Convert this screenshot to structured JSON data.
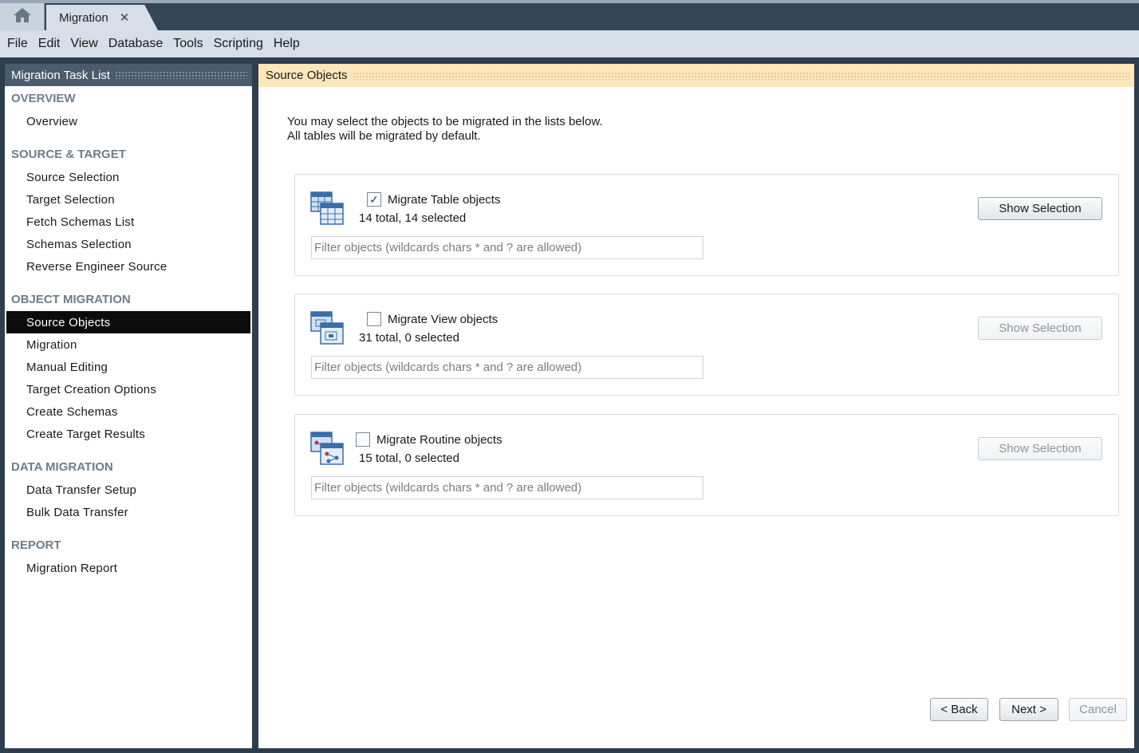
{
  "tabs": {
    "home_icon": "home-icon",
    "document": {
      "title": "Migration",
      "close_glyph": "✕"
    }
  },
  "menubar": [
    "File",
    "Edit",
    "View",
    "Database",
    "Tools",
    "Scripting",
    "Help"
  ],
  "sidebar": {
    "title": "Migration Task List",
    "sections": [
      {
        "title": "OVERVIEW",
        "items": [
          "Overview"
        ]
      },
      {
        "title": "SOURCE & TARGET",
        "items": [
          "Source Selection",
          "Target Selection",
          "Fetch Schemas List",
          "Schemas Selection",
          "Reverse Engineer Source"
        ]
      },
      {
        "title": "OBJECT MIGRATION",
        "items": [
          "Source Objects",
          "Migration",
          "Manual Editing",
          "Target Creation Options",
          "Create Schemas",
          "Create Target Results"
        ]
      },
      {
        "title": "DATA MIGRATION",
        "items": [
          "Data Transfer Setup",
          "Bulk Data Transfer"
        ]
      },
      {
        "title": "REPORT",
        "items": [
          "Migration Report"
        ]
      }
    ],
    "active_item": "Source Objects"
  },
  "main": {
    "title": "Source Objects",
    "intro_line1": "You may select the objects to be migrated in the lists below.",
    "intro_line2": "All tables will be migrated by default.",
    "panels": [
      {
        "label": "Migrate Table objects",
        "count": "14 total, 14 selected",
        "checked": true,
        "filter_placeholder": "Filter objects (wildcards chars * and ? are allowed)",
        "button": "Show Selection",
        "button_enabled": true,
        "icon": "table-objects-icon"
      },
      {
        "label": "Migrate View objects",
        "count": "31 total, 0 selected",
        "checked": false,
        "filter_placeholder": "Filter objects (wildcards chars * and ? are allowed)",
        "button": "Show Selection",
        "button_enabled": false,
        "icon": "view-objects-icon"
      },
      {
        "label": "Migrate Routine objects",
        "count": "15 total, 0 selected",
        "checked": false,
        "filter_placeholder": "Filter objects (wildcards chars * and ? are allowed)",
        "button": "Show Selection",
        "button_enabled": false,
        "icon": "routine-objects-icon"
      }
    ],
    "buttons": {
      "back": "< Back",
      "next": "Next >",
      "cancel": "Cancel"
    }
  },
  "colors": {
    "tabbar": "#35455a",
    "menubar": "#d6dee7",
    "sidebar_header": "#4a5b6e",
    "main_header": "#fde6b9",
    "active_item": "#0b0b0b",
    "section_title": "#6f7c8c"
  }
}
